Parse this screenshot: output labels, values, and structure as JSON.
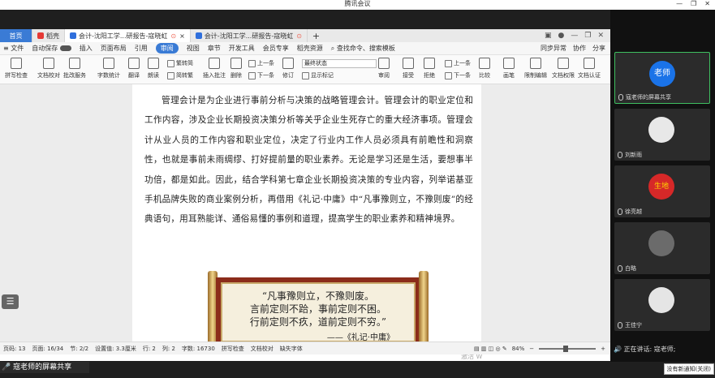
{
  "app_title": "腾讯会议",
  "window_controls": [
    "—",
    "❐",
    "✕"
  ],
  "wps": {
    "tabs": [
      {
        "label": "首页",
        "kind": "home"
      },
      {
        "label": "稻壳",
        "kind": "normal",
        "color": "#e53935"
      },
      {
        "label": "会计-沈阳工学...研报告-寇晓虹",
        "kind": "active",
        "color": "#2f6fdc"
      },
      {
        "label": "会计-沈阳工学...研报告-寇晓虹",
        "kind": "normal",
        "color": "#2f6fdc"
      }
    ],
    "new_tab": "+",
    "menu": {
      "file": "≡ 文件",
      "autosave": "自动保存",
      "items": [
        "插入",
        "页面布局",
        "引用",
        "审阅",
        "视图",
        "章节",
        "开发工具",
        "会员专享",
        "稻壳资源"
      ],
      "active_item": "审阅",
      "search_placeholder": "查找命令、搜索模板",
      "sync": "同步异常",
      "collab": "协作",
      "share": "分享"
    },
    "ribbon": {
      "spell_check": "拼写检查",
      "doc_proof": "文档校对",
      "annot_service": "批改服务",
      "word_count": "字数统计",
      "translate": "翻译",
      "read_aloud": "朗读",
      "simp_trad": "繁转简",
      "trad_simp": "简转繁",
      "insert_comment": "插入批注",
      "delete": "删除",
      "prev": "上一条",
      "next": "下一条",
      "revise": "修订",
      "final_status": "最终状态",
      "show_marks": "显示标记",
      "review": "审阅",
      "accept": "接受",
      "reject": "拒绝",
      "prev2": "上一条",
      "next2": "下一条",
      "compare": "比较",
      "pen": "画笔",
      "restrict_edit": "限制编辑",
      "doc_permission": "文档权限",
      "doc_cert": "文档认证"
    },
    "body_text": "管理会计是为企业进行事前分析与决策的战略管理会计。管理会计的职业定位和工作内容，涉及企业长期投资决策分析等关乎企业生死存亡的重大经济事项。管理会计从业人员的工作内容和职业定位，决定了行业内工作人员必须具有前瞻性和洞察性，也就是事前未雨绸缪、打好提前量的职业素养。无论是学习还是生活，要想事半功倍，都是如此。因此，结合学科第七章企业长期投资决策的专业内容，列举诺基亚手机品牌失败的商业案例分析，再借用《礼记·中庸》中“凡事豫则立，不豫则废”的经典语句，用耳熟能详、通俗易懂的事例和道理，提高学生的职业素养和精神境界。",
    "scroll_lines": [
      "“凡事豫则立，不豫则废。",
      "言前定则不跲，事前定则不困。",
      "行前定则不疚，道前定则不穷。”"
    ],
    "scroll_attrib": "——《礼记·中庸》",
    "watermark": "激活 W",
    "status": {
      "page_no": "页码: 13",
      "pages": "页面: 16/34",
      "section": "节: 2/2",
      "setting": "设置值: 3.3厘米",
      "row": "行: 2",
      "col": "列: 2",
      "words": "字数: 16730",
      "spell": "拼写检查",
      "proof": "文档校对",
      "missing_font": "缺失字体",
      "zoom": "84%"
    }
  },
  "share_label": "寇老师的屏幕共享",
  "participants": [
    {
      "name": "寇老师的屏幕共享",
      "avatar_text": "老师",
      "color": "#1a73e8",
      "active": true
    },
    {
      "name": "刘新雨",
      "avatar_text": "",
      "color": "#e8e8e8",
      "active": false
    },
    {
      "name": "徐亮越",
      "avatar_text": "生地",
      "color": "#d62828",
      "active": false
    },
    {
      "name": "白略",
      "avatar_text": "",
      "color": "#6b6b6b",
      "active": false
    },
    {
      "name": "王佳宁",
      "avatar_text": "",
      "color": "#e5e5e5",
      "active": false
    }
  ],
  "speaking": "正在讲话: 寇老师;",
  "notice": "没有新通知(关闭)"
}
